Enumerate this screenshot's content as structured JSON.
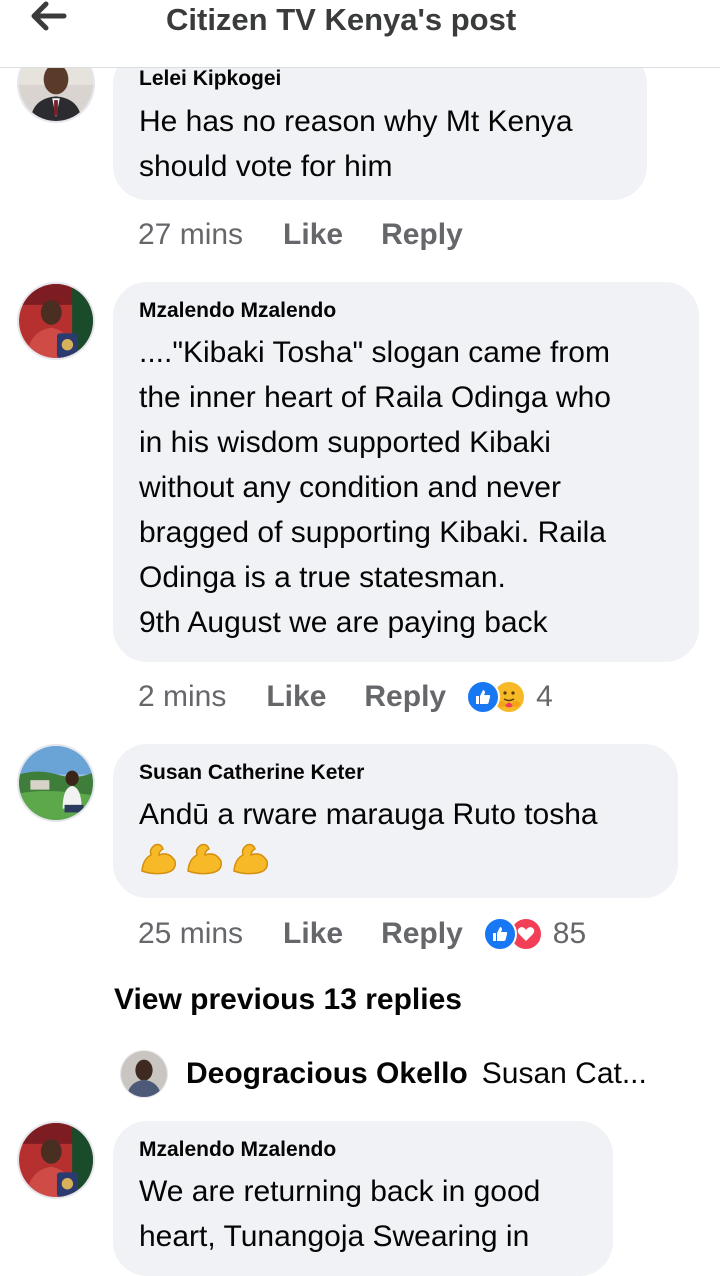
{
  "header": {
    "title": "Citizen TV Kenya's post",
    "back_icon": "arrow-left-icon"
  },
  "comments": [
    {
      "author": "Lelei Kipkogei",
      "text": "He has no reason why Mt Kenya\nshould vote for him",
      "time": "27 mins",
      "like_label": "Like",
      "reply_label": "Reply"
    },
    {
      "author": "Mzalendo Mzalendo",
      "text": "....\"Kibaki Tosha\" slogan came from\nthe inner heart of Raila Odinga who\nin his wisdom supported Kibaki\nwithout any condition and never\nbragged of supporting Kibaki. Raila\nOdinga is a true statesman.\n9th August we are paying back",
      "time": "2 mins",
      "like_label": "Like",
      "reply_label": "Reply",
      "reactions": [
        "like-reaction-icon",
        "care-reaction-icon"
      ],
      "reaction_count": "4"
    },
    {
      "author": "Susan Catherine Keter",
      "text": "Andū a rware marauga Ruto tosha",
      "emojis": "💪💪💪",
      "time": "25 mins",
      "like_label": "Like",
      "reply_label": "Reply",
      "reactions": [
        "like-reaction-icon",
        "love-reaction-icon"
      ],
      "reaction_count": "85"
    },
    {
      "author": "Mzalendo Mzalendo",
      "text": "We are returning back in good\nheart, Tunangoja Swearing in"
    }
  ],
  "view_previous_label": "View previous 13 replies",
  "reply_preview": {
    "author": "Deogracious Okello",
    "text": "Susan Cat..."
  },
  "colors": {
    "bubble_bg": "#f0f2f5",
    "secondary_text": "#65676b",
    "like_blue": "#1877f2",
    "love_red": "#f33e58",
    "care_yellow": "#f7b928"
  }
}
